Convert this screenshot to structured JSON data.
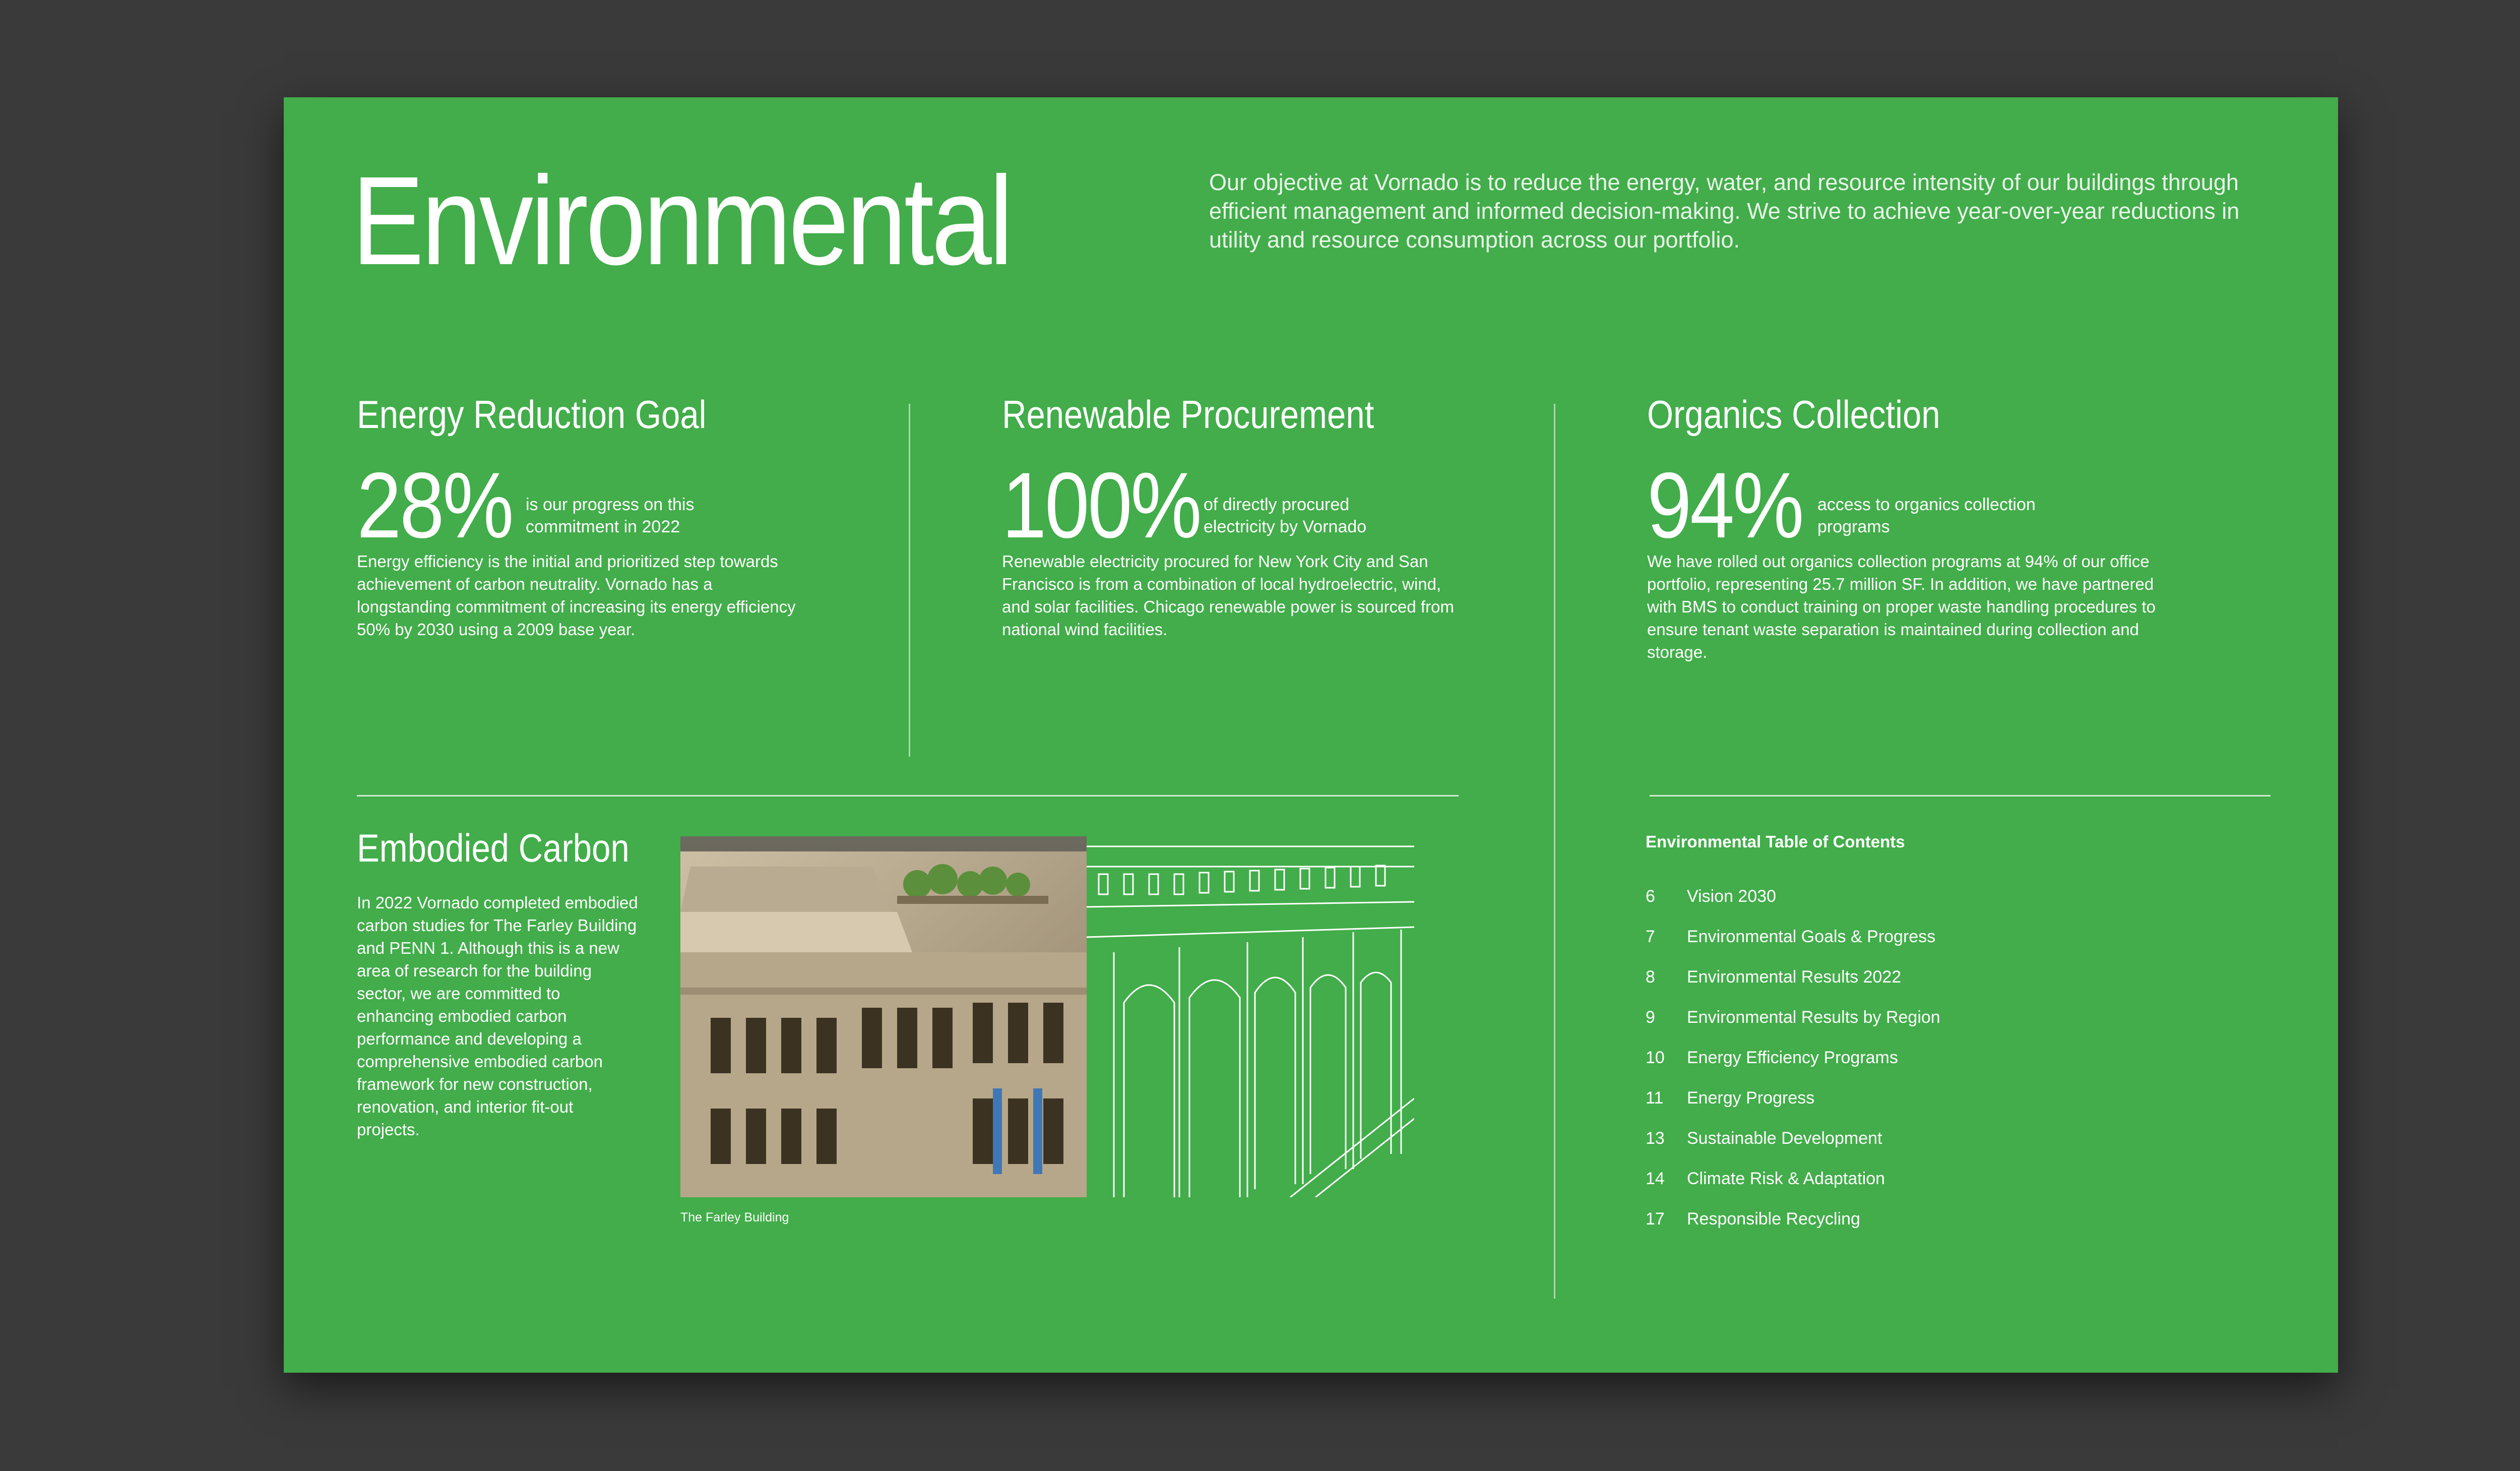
{
  "header": {
    "title": "Environmental",
    "intro": "Our objective at Vornado is to reduce the energy, water, and resource intensity of our buildings through efficient management and informed decision-making. We strive to achieve year-over-year reductions in utility and resource consumption across our portfolio."
  },
  "stats": [
    {
      "heading": "Energy Reduction Goal",
      "value": "28%",
      "note": "is our progress on this commitment in 2022",
      "body": "Energy efficiency is the initial and prioritized step towards achievement of carbon neutrality. Vornado has a longstanding commitment of increasing its energy efficiency 50% by 2030 using a 2009 base year."
    },
    {
      "heading": "Renewable Procurement",
      "value": "100%",
      "note": "of directly procured electricity by Vornado",
      "body": "Renewable electricity procured for New York City and San Francisco is from a combination of local hydroelectric, wind, and solar facilities. Chicago renewable power is sourced from national wind facilities."
    },
    {
      "heading": "Organics Collection",
      "value": "94%",
      "note": "access to organics collection programs",
      "body": "We have rolled out organics collection programs at 94% of our office portfolio, representing 25.7 million SF. In addition, we have partnered with BMS to conduct training on proper waste handling procedures to ensure tenant waste separation is maintained during collection and storage."
    }
  ],
  "embodied_carbon": {
    "heading": "Embodied Carbon",
    "body": "In 2022 Vornado completed embodied carbon studies for The Farley Building and PENN 1. Although this is a new area of research for the building sector, we are committed to enhancing embodied carbon performance and developing a comprehensive embodied carbon framework for new construction, renovation, and interior fit-out projects.",
    "caption": "The Farley Building"
  },
  "toc": {
    "title": "Environmental Table of Contents",
    "items": [
      {
        "page": "6",
        "label": "Vision 2030"
      },
      {
        "page": "7",
        "label": "Environmental Goals & Progress"
      },
      {
        "page": "8",
        "label": "Environmental Results 2022"
      },
      {
        "page": "9",
        "label": "Environmental Results by Region"
      },
      {
        "page": "10",
        "label": "Energy Efficiency Programs"
      },
      {
        "page": "11",
        "label": "Energy Progress"
      },
      {
        "page": "13",
        "label": "Sustainable Development"
      },
      {
        "page": "14",
        "label": "Climate Risk & Adaptation"
      },
      {
        "page": "17",
        "label": "Responsible Recycling"
      }
    ]
  },
  "colors": {
    "page_green": "#42ad4a",
    "background": "#3a3a3a",
    "text": "#ffffff"
  }
}
